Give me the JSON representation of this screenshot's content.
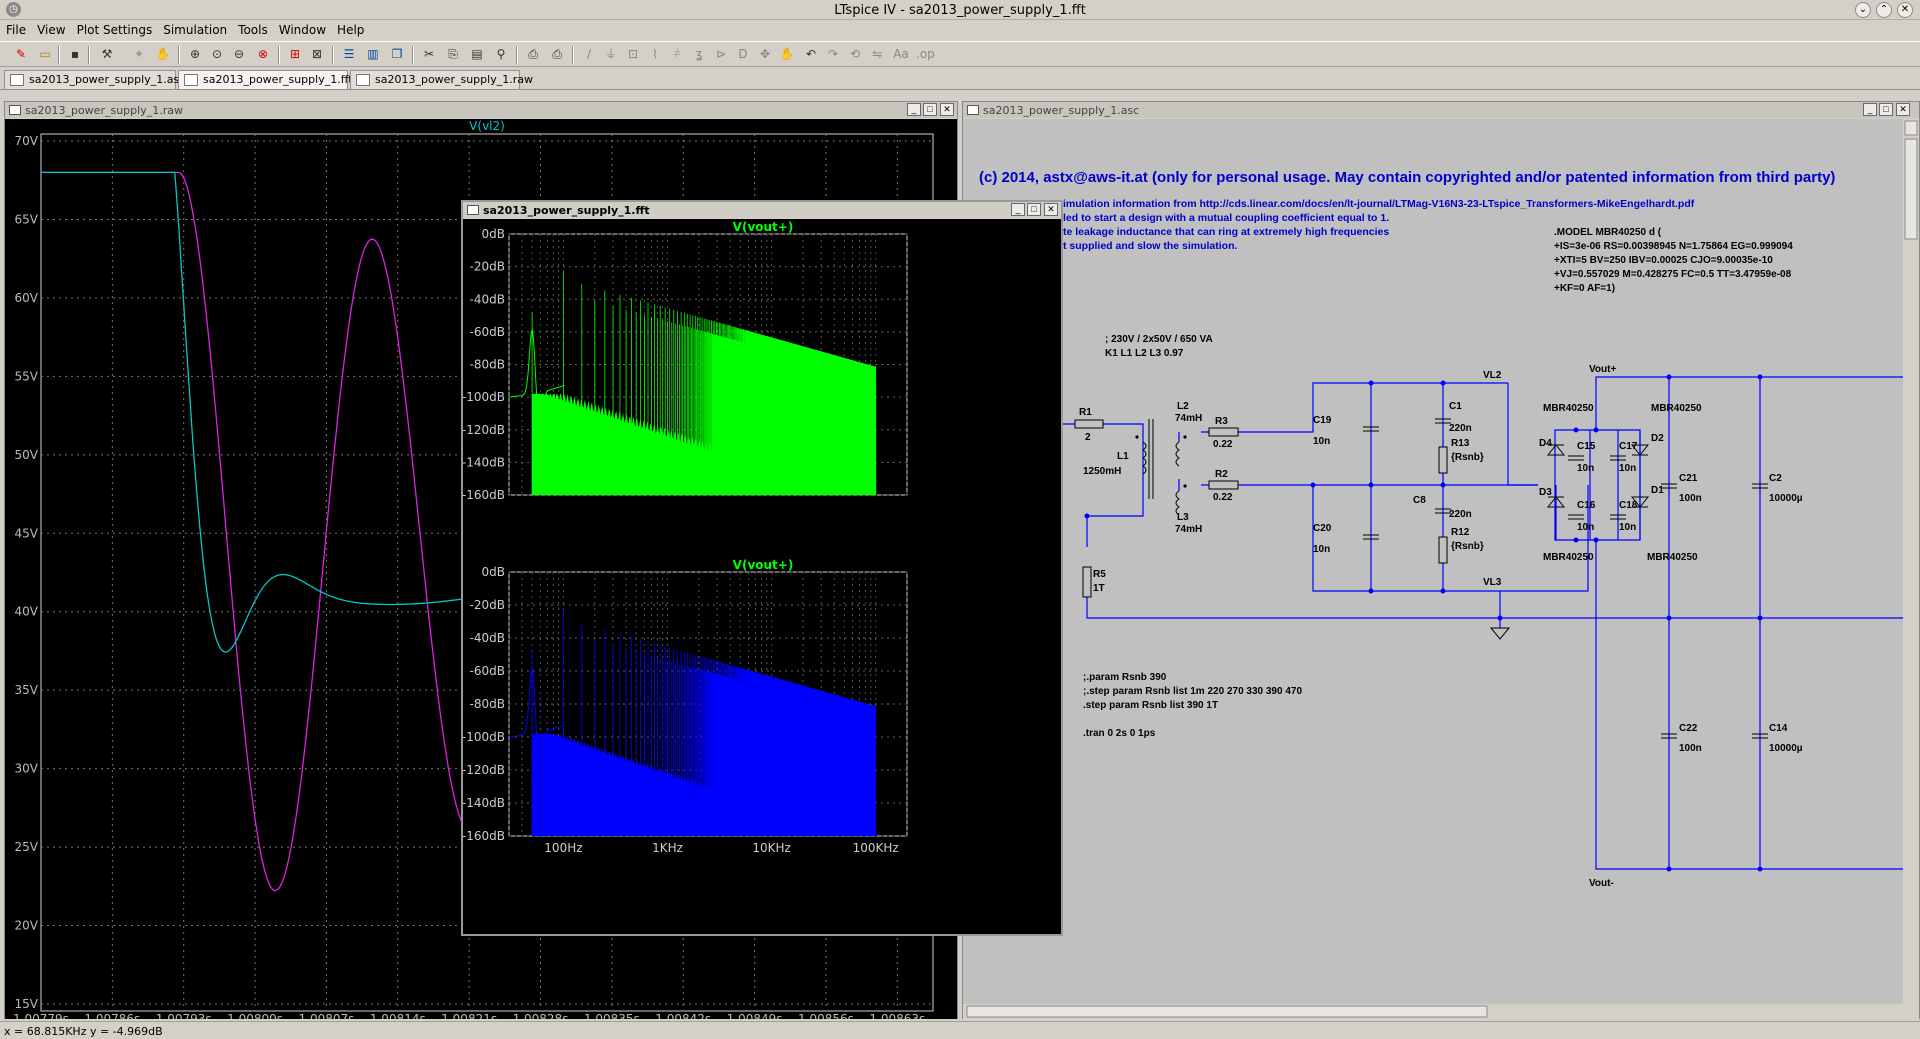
{
  "window": {
    "title": "LTspice IV - sa2013_power_supply_1.fft"
  },
  "menu": {
    "items": [
      "File",
      "View",
      "Plot Settings",
      "Simulation",
      "Tools",
      "Window",
      "Help"
    ]
  },
  "doc_tabs": [
    "sa2013_power_supply_1.asc",
    "sa2013_power_supply_1.fft",
    "sa2013_power_supply_1.raw"
  ],
  "raw_window": {
    "caption": "sa2013_power_supply_1.raw",
    "trace_label": "V(vl2)",
    "colors": {
      "v_vl2": "#00c8c8",
      "other": "#e020e0"
    },
    "y_ticks": [
      "70V",
      "65V",
      "60V",
      "55V",
      "50V",
      "45V",
      "40V",
      "35V",
      "30V",
      "25V",
      "20V",
      "15V"
    ],
    "x_ticks": [
      "1.00779s",
      "1.00786s",
      "1.00793s",
      "1.00800s",
      "1.00807s",
      "1.00814s",
      "1.00821s",
      "1.00828s",
      "1.00835s",
      "1.00842s",
      "1.00849s",
      "1.00856s",
      "1.00863s"
    ]
  },
  "fft_window": {
    "caption": "sa2013_power_supply_1.fft",
    "top_pane": {
      "trace_label": "V(vout+)",
      "color": "#00ff00"
    },
    "bottom_pane": {
      "trace_label": "V(vout+)",
      "color": "#0000ff"
    },
    "y_ticks": [
      "0dB",
      "-20dB",
      "-40dB",
      "-60dB",
      "-80dB",
      "-100dB",
      "-120dB",
      "-140dB",
      "-160dB"
    ],
    "x_ticks": [
      "100Hz",
      "1KHz",
      "10KHz",
      "100KHz"
    ]
  },
  "asc_window": {
    "caption": "sa2013_power_supply_1.asc",
    "copyright": "(c) 2014, astx@aws-it.at (only for personal usage. May contain copyrighted and/or patented information from third party)",
    "notes": [
      "imulation information from http://cds.linear.com/docs/en/lt-journal/LTMag-V16N3-23-LTspice_Transformers-MikeEngelhardt.pdf",
      "led to start a design with a mutual coupling coefficient equal to 1.",
      "te leakage inductance that can ring at extremely high frequencies",
      "t supplied and slow the simulation."
    ],
    "model": [
      ".MODEL MBR40250 d (",
      "+IS=3e-06 RS=0.00398945 N=1.75864 EG=0.999094",
      "+XTI=5 BV=250 IBV=0.00025 CJO=9.00035e-10",
      "+VJ=0.557029 M=0.428275 FC=0.5 TT=3.47959e-08",
      "+KF=0 AF=1)"
    ],
    "transformer_comment": [
      "; 230V / 2x50V / 650 VA",
      "K1 L1 L2  L3 0.97"
    ],
    "directives": [
      ";.param Rsnb 390",
      ";.step param Rsnb list 1m 220 270 330 390 470",
      ".step param Rsnb list 390 1T",
      ".tran 0 2s 0 1ps"
    ],
    "labels": {
      "r1": "R1",
      "r1v": "2",
      "l1": "L1",
      "l1v": "1250mH",
      "r5": "R5",
      "r5v": "1T",
      "l2": "L2",
      "l2v": "74mH",
      "l3": "L3",
      "l3v": "74mH",
      "r3": "R3",
      "r3v": "0.22",
      "r2": "R2",
      "r2v": "0.22",
      "c19": "C19",
      "c19v": "10n",
      "c20": "C20",
      "c20v": "10n",
      "c1": "C1",
      "c1v": "220n",
      "r13": "R13",
      "r13v": "{Rsnb}",
      "c8": "C8",
      "c8v": "220n",
      "r12": "R12",
      "r12v": "{Rsnb}",
      "vl2": "VL2",
      "vl3": "VL3",
      "mbr_tl": "MBR40250",
      "mbr_tr": "MBR40250",
      "mbr_bl": "MBR40250",
      "mbr_br": "MBR40250",
      "d4": "D4",
      "d2": "D2",
      "d3": "D3",
      "d1": "D1",
      "c15": "C15",
      "c15v": "10n",
      "c17": "C17",
      "c17v": "10n",
      "c16": "C16",
      "c16v": "10n",
      "c18": "C18",
      "c18v": "10n",
      "vout_p": "Vout+",
      "vout_m": "Vout-",
      "c21": "C21",
      "c21v": "100n",
      "c2": "C2",
      "c2v": "10000µ",
      "c22": "C22",
      "c22v": "100n",
      "c14": "C14",
      "c14v": "10000µ"
    }
  },
  "status": {
    "readout": "x = 68.815KHz    y = -4.969dB"
  }
}
